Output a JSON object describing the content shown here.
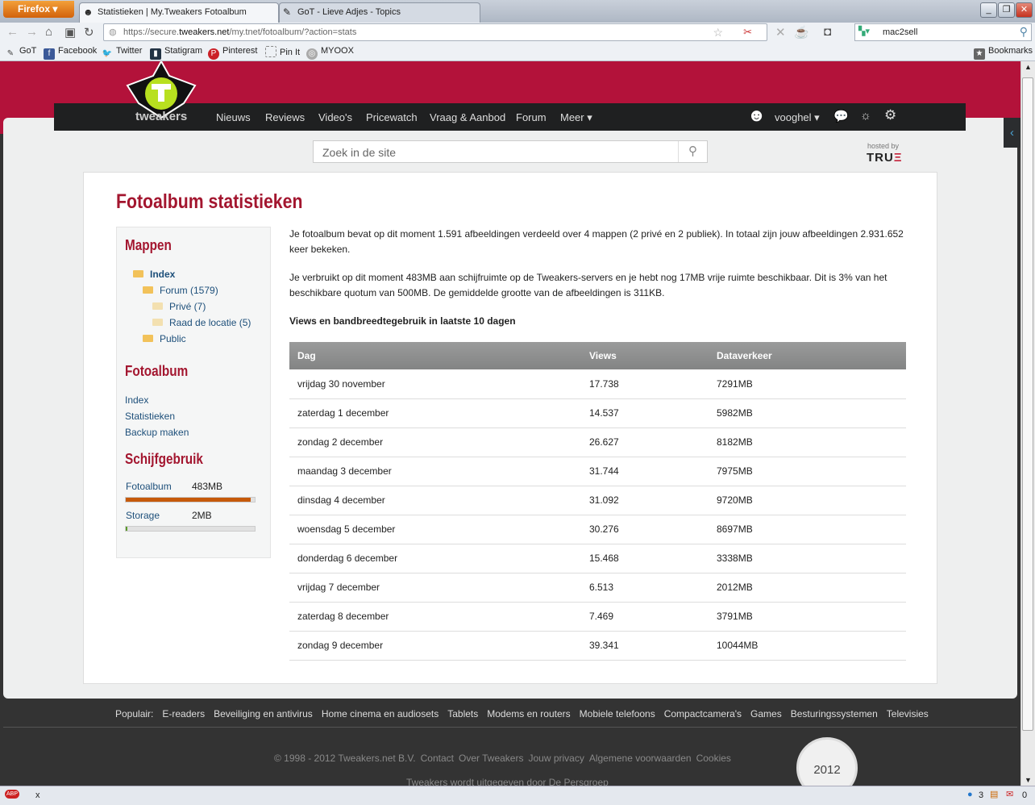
{
  "browser": {
    "menu": "Firefox",
    "tabs": [
      {
        "title": "Statistieken | My.Tweakers Fotoalbum"
      },
      {
        "title": "GoT - Lieve Adjes - Topics"
      }
    ],
    "url_host": "https://secure.",
    "url_domain": "tweakers.net",
    "url_path": "/my.tnet/fotoalbum/?action=stats",
    "search_engine_value": "mac2sell",
    "bookmarks": [
      "GoT",
      "Facebook",
      "Twitter",
      "Statigram",
      "Pinterest",
      "Pin It",
      "MYOOX"
    ],
    "bookmarks_menu": "Bookmarks",
    "status": {
      "x": "x",
      "count1": "3",
      "count2": "0"
    }
  },
  "site": {
    "logo": "tweakers",
    "nav": [
      "Nieuws",
      "Reviews",
      "Video's",
      "Pricewatch",
      "Vraag & Aanbod",
      "Forum",
      "Meer ▾"
    ],
    "user": "vooghel ▾",
    "search_placeholder": "Zoek in de site",
    "hosted_by": "hosted by",
    "host": "TRU",
    "host_e": "Ξ"
  },
  "page": {
    "title": "Fotoalbum statistieken",
    "sidebar": {
      "mappen_title": "Mappen",
      "folders": [
        {
          "label": "Index"
        },
        {
          "label": "Forum (1579)"
        },
        {
          "label": "Privé (7)"
        },
        {
          "label": "Raad de locatie (5)"
        },
        {
          "label": "Public"
        }
      ],
      "fotoalbum_title": "Fotoalbum",
      "links": [
        "Index",
        "Statistieken",
        "Backup maken"
      ],
      "disk_title": "Schijfgebruik",
      "usage": [
        {
          "label": "Fotoalbum",
          "value": "483MB",
          "fraction": 0.966,
          "color": "#c65a0b"
        },
        {
          "label": "Storage",
          "value": "2MB",
          "fraction": 0.01,
          "color": "#5a9a2a"
        }
      ]
    },
    "intro1": "Je fotoalbum bevat op dit moment 1.591 afbeeldingen verdeeld over 4 mappen (2 privé en 2 publiek). In totaal zijn jouw afbeeldingen 2.931.652 keer bekeken.",
    "intro2": "Je verbruikt op dit moment 483MB aan schijfruimte op de Tweakers-servers en je hebt nog 17MB vrije ruimte beschikbaar. Dit is 3% van het beschikbare quotum van 500MB. De gemiddelde grootte van de afbeeldingen is 311KB.",
    "table_title": "Views en bandbreedtegebruik in laatste 10 dagen",
    "table": {
      "headers": [
        "Dag",
        "Views",
        "Dataverkeer"
      ],
      "rows": [
        [
          "vrijdag 30 november",
          "17.738",
          "7291MB"
        ],
        [
          "zaterdag 1 december",
          "14.537",
          "5982MB"
        ],
        [
          "zondag 2 december",
          "26.627",
          "8182MB"
        ],
        [
          "maandag 3 december",
          "31.744",
          "7975MB"
        ],
        [
          "dinsdag 4 december",
          "31.092",
          "9720MB"
        ],
        [
          "woensdag 5 december",
          "30.276",
          "8697MB"
        ],
        [
          "donderdag 6 december",
          "15.468",
          "3338MB"
        ],
        [
          "vrijdag 7 december",
          "6.513",
          "2012MB"
        ],
        [
          "zaterdag 8 december",
          "7.469",
          "3791MB"
        ],
        [
          "zondag 9 december",
          "39.341",
          "10044MB"
        ]
      ]
    }
  },
  "footer": {
    "popular": [
      "Populair:",
      "E-readers",
      "Beveiliging en antivirus",
      "Home cinema en audiosets",
      "Tablets",
      "Modems en routers",
      "Mobiele telefoons",
      "Compactcamera's",
      "Games",
      "Besturingssystemen",
      "Televisies"
    ],
    "copy": [
      "© 1998 - 2012 Tweakers.net B.V.",
      "Contact",
      "Over Tweakers",
      "Jouw privacy",
      "Algemene voorwaarden",
      "Cookies"
    ],
    "publisher": "Tweakers wordt uitgegeven door De Persgroep",
    "medal": "2012"
  }
}
